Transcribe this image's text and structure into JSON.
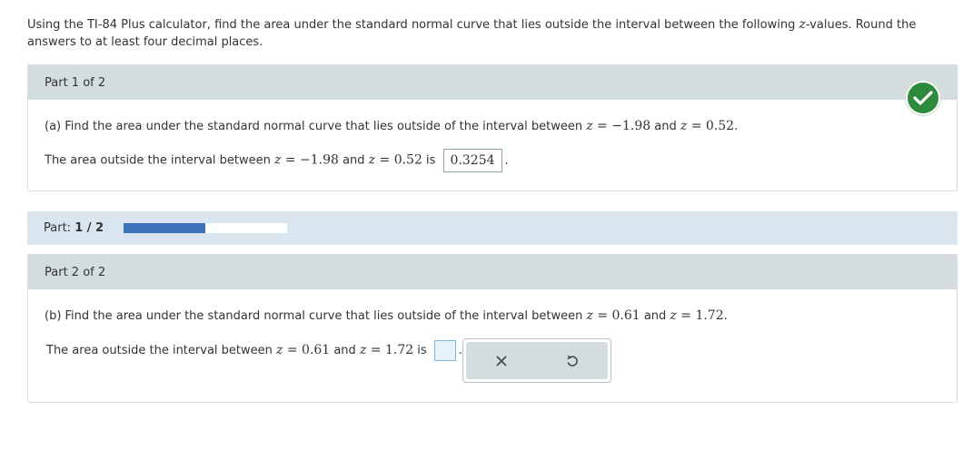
{
  "intro": {
    "text_part1": "Using the TI-84 Plus calculator, find the area under the standard normal curve that lies outside the interval between the following ",
    "z_var": "z",
    "text_part2": "-values. Round the answers to at least four decimal places."
  },
  "part1": {
    "header": "Part 1 of 2",
    "question_prefix": "(a) Find the area under the standard normal curve that lies outside of the interval between ",
    "z1": "−1.98",
    "and": " and ",
    "z2": "0.52",
    "question_suffix": ".",
    "answer_prefix": "The area outside the interval between ",
    "answer_is": " is ",
    "answer_value": "0.3254",
    "answer_suffix": ".",
    "status": "correct"
  },
  "progress": {
    "label": "Part: ",
    "value_text": "1 / 2",
    "fraction": 0.5
  },
  "part2": {
    "header": "Part 2 of 2",
    "question_prefix": "(b) Find the area under the standard normal curve that lies outside of the interval between ",
    "z1": "0.61",
    "and": " and ",
    "z2": "1.72",
    "question_suffix": ".",
    "answer_prefix": "The area outside the interval between ",
    "answer_is": " is ",
    "answer_value": "",
    "answer_suffix": "."
  },
  "toolbox": {
    "clear_icon": "close-icon",
    "undo_icon": "undo-icon"
  },
  "colors": {
    "header_bg": "#d3dcdf",
    "progress_bg": "#d9e6ef",
    "progress_fill": "#3c73b8",
    "check_green": "#2e8b3e"
  }
}
